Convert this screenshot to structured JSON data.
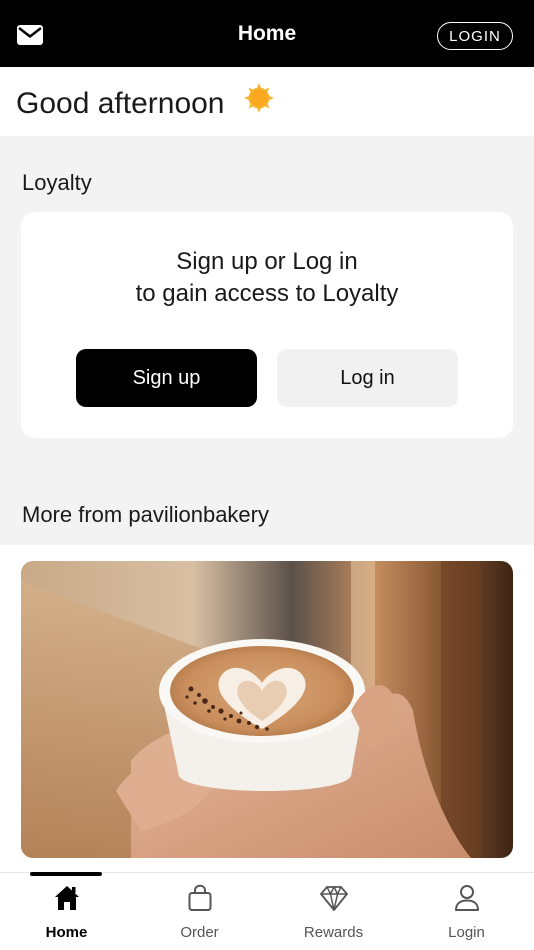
{
  "header": {
    "title": "Home",
    "login_label": "LOGIN",
    "mail_icon": "envelope-icon"
  },
  "greeting": {
    "text": "Good afternoon",
    "icon": "sun-icon"
  },
  "loyalty": {
    "section_title": "Loyalty",
    "message_line1": "Sign up or Log in",
    "message_line2": "to gain access to Loyalty",
    "signup_label": "Sign up",
    "login_label": "Log in"
  },
  "more": {
    "section_title": "More from pavilionbakery",
    "image": "latte-art-coffee-cup-photo"
  },
  "tabs": [
    {
      "label": "Home",
      "icon": "home-icon",
      "active": true
    },
    {
      "label": "Order",
      "icon": "shopping-bag-icon",
      "active": false
    },
    {
      "label": "Rewards",
      "icon": "diamond-icon",
      "active": false
    },
    {
      "label": "Login",
      "icon": "person-icon",
      "active": false
    }
  ],
  "colors": {
    "header_bg": "#000000",
    "page_bg": "#f3f3f3",
    "primary_button": "#000000",
    "secondary_button": "#f1f1f1",
    "sun": "#f5a623"
  }
}
